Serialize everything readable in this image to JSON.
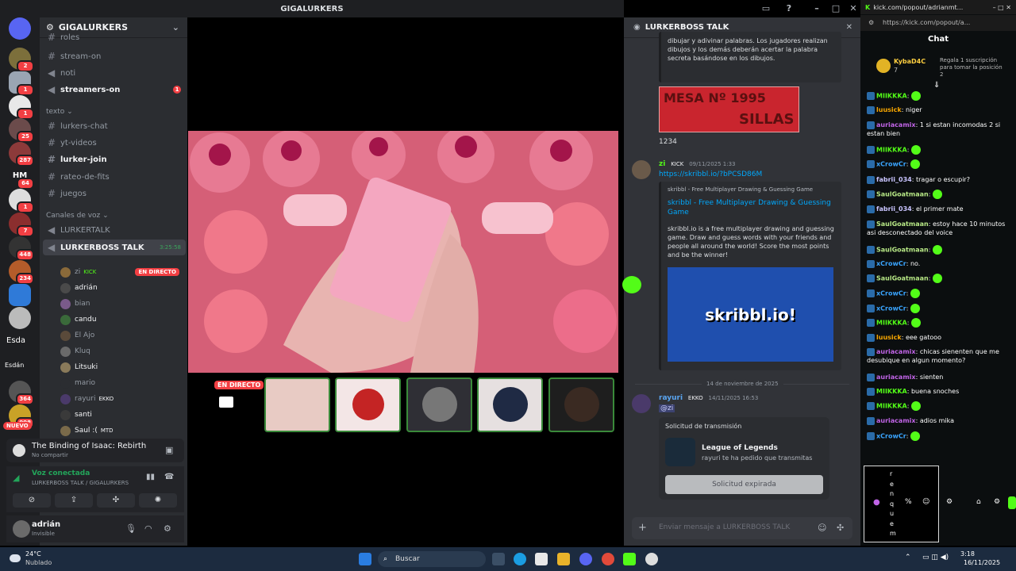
{
  "window": {
    "title": "GIGALURKERS"
  },
  "rail": {
    "badges": [
      "2",
      "1",
      "1",
      "25",
      "287",
      "64",
      "1",
      "7",
      "448",
      "234",
      "364",
      "998"
    ],
    "text_items": [
      "HM",
      "Esda",
      "Esdán"
    ],
    "nuevo": "NUEVO"
  },
  "guild": {
    "name": "GIGALURKERS",
    "channels_top": [
      {
        "name": "roles",
        "icon": "#"
      },
      {
        "name": "stream-on",
        "icon": "#"
      },
      {
        "name": "noti",
        "icon": "speaker"
      },
      {
        "name": "streamers-on",
        "icon": "speaker",
        "badge": "1"
      }
    ],
    "text_category": "texto",
    "text_channels": [
      "lurkers-chat",
      "yt-videos",
      "lurker-join",
      "rateo-de-fits",
      "juegos"
    ],
    "voice_category": "Canales de voz",
    "voice_channels": [
      "LURKERTALK",
      "LURKERBOSS TALK"
    ],
    "voice_timer": "3:25:58",
    "voice_users": [
      {
        "name": "zi",
        "tag": "KICK",
        "live": "EN DIRECTO"
      },
      {
        "name": "adrián"
      },
      {
        "name": "bian"
      },
      {
        "name": "candu"
      },
      {
        "name": "El Ajo"
      },
      {
        "name": "Kluq"
      },
      {
        "name": "Litsuki"
      },
      {
        "name": "mario"
      },
      {
        "name": "rayuri",
        "tag": "EKKO"
      },
      {
        "name": "santi"
      },
      {
        "name": "Saul :(",
        "tag": "MTD"
      }
    ]
  },
  "game_panel": {
    "title": "The Binding of Isaac: Rebirth",
    "subtitle": "No compartir"
  },
  "voice_panel": {
    "status": "Voz conectada",
    "location": "LURKERBOSS TALK / GIGALURKERS"
  },
  "user_panel": {
    "name": "adrián",
    "status": "Invisible"
  },
  "stage": {
    "live_label": "EN DIRECTO"
  },
  "chat": {
    "header": "LURKERBOSS TALK",
    "embed1_text": "dibujar y adivinar palabras. Los jugadores realizan dibujos y los demás deberán acertar la palabra secreta basándose en los dibujos.",
    "mesa_line1": "MESA Nº 1995",
    "mesa_line2": "SILLAS",
    "count": "1234",
    "msg1": {
      "author": "zi",
      "tag": "KICK",
      "time": "09/11/2025 1:33",
      "link": "https://skribbl.io/?bPCSD86M"
    },
    "embed2": {
      "site": "skribbl - Free Multiplayer Drawing & Guessing Game",
      "title": "skribbl - Free Multiplayer Drawing & Guessing Game",
      "desc": "skribbl.io is a free multiplayer drawing and guessing game. Draw and guess words with your friends and people all around the world! Score the most points and be the winner!",
      "logo": "skribbl.io!"
    },
    "date_divider": "14 de noviembre de 2025",
    "msg2": {
      "author": "rayuri",
      "tag": "EKKO",
      "time": "14/11/2025 16:53",
      "mention": "@zi"
    },
    "request": {
      "title": "Solicitud de transmisión",
      "game": "League of Legends",
      "sub": "rayuri te ha pedido que transmitas",
      "button": "Solicitud expirada"
    },
    "input_placeholder": "Enviar mensaje a LURKERBOSS TALK"
  },
  "kick": {
    "tab": "kick.com/popout/adrianmt...",
    "url": "https://kick.com/popout/a...",
    "title": "Chat",
    "gift_user": "KybaD4C",
    "gift_count": "7",
    "gift_text": "Regala 1 suscripción para tomar la posición 2",
    "messages": [
      {
        "user": "MIIKKKA",
        "text": ""
      },
      {
        "user": "luusick",
        "text": "niger"
      },
      {
        "user": "auriacamix",
        "text": "1 si estan incomodas 2 si estan bien"
      },
      {
        "user": "MIIKKKA",
        "text": ""
      },
      {
        "user": "xCrowCr",
        "text": ""
      },
      {
        "user": "fabrii_034",
        "text": "tragar o escupir?"
      },
      {
        "user": "SaulGoatmaan",
        "text": ""
      },
      {
        "user": "fabrii_034",
        "text": "el primer mate"
      },
      {
        "user": "SaulGoatmaan",
        "text": "estoy hace 10 minutos asi desconectado del voice"
      },
      {
        "user": "SaulGoatmaan",
        "text": ""
      },
      {
        "user": "xCrowCr",
        "text": "no."
      },
      {
        "user": "SaulGoatmaan",
        "text": ""
      },
      {
        "user": "xCrowCr",
        "text": ""
      },
      {
        "user": "xCrowCr",
        "text": ""
      },
      {
        "user": "MIIKKKA",
        "text": ""
      },
      {
        "user": "luusick",
        "text": "eee gatooo"
      },
      {
        "user": "auriacamix",
        "text": "chicas sienenten que me desubique en algun momento?"
      },
      {
        "user": "auriacamix",
        "text": "sienten"
      },
      {
        "user": "MIIKKKA",
        "text": "buena snoches"
      },
      {
        "user": "MIIKKKA",
        "text": ""
      },
      {
        "user": "auriacamix",
        "text": "adios mika"
      },
      {
        "user": "xCrowCr",
        "text": ""
      }
    ],
    "typing_letters": [
      "r",
      "e",
      "n",
      "q",
      "u",
      "e",
      "m"
    ]
  },
  "taskbar": {
    "weather_temp": "24°C",
    "weather_desc": "Nublado",
    "search": "Buscar",
    "time": "3:18",
    "date": "16/11/2025"
  },
  "colors": {
    "discord_bg": "#313338",
    "kick_green": "#53fc18",
    "live_red": "#f23f43"
  }
}
